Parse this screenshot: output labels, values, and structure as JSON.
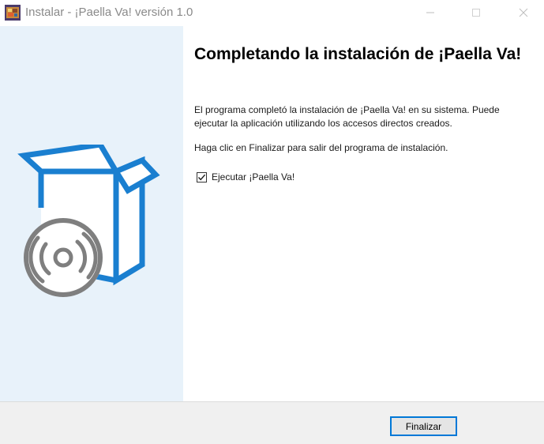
{
  "window": {
    "title": "Instalar - ¡Paella Va! versión 1.0",
    "icon": "installer-app-icon",
    "controls": {
      "minimize_icon": "minimize-icon",
      "maximize_icon": "maximize-icon",
      "close_icon": "close-icon"
    }
  },
  "sidebar": {
    "graphic": "software-box-with-disc-icon",
    "background_color": "#e8f2fa",
    "accent_color": "#1a7fd0",
    "disc_color": "#7f7f7f"
  },
  "content": {
    "heading": "Completando la instalación de ¡Paella Va!",
    "paragraph1": "El programa completó la instalación de ¡Paella Va! en su sistema. Puede ejecutar la aplicación utilizando los accesos directos creados.",
    "paragraph2": "Haga clic en Finalizar para salir del programa de instalación.",
    "run_checkbox": {
      "label": "Ejecutar ¡Paella Va!",
      "checked": true
    }
  },
  "footer": {
    "finish_label": "Finalizar"
  }
}
